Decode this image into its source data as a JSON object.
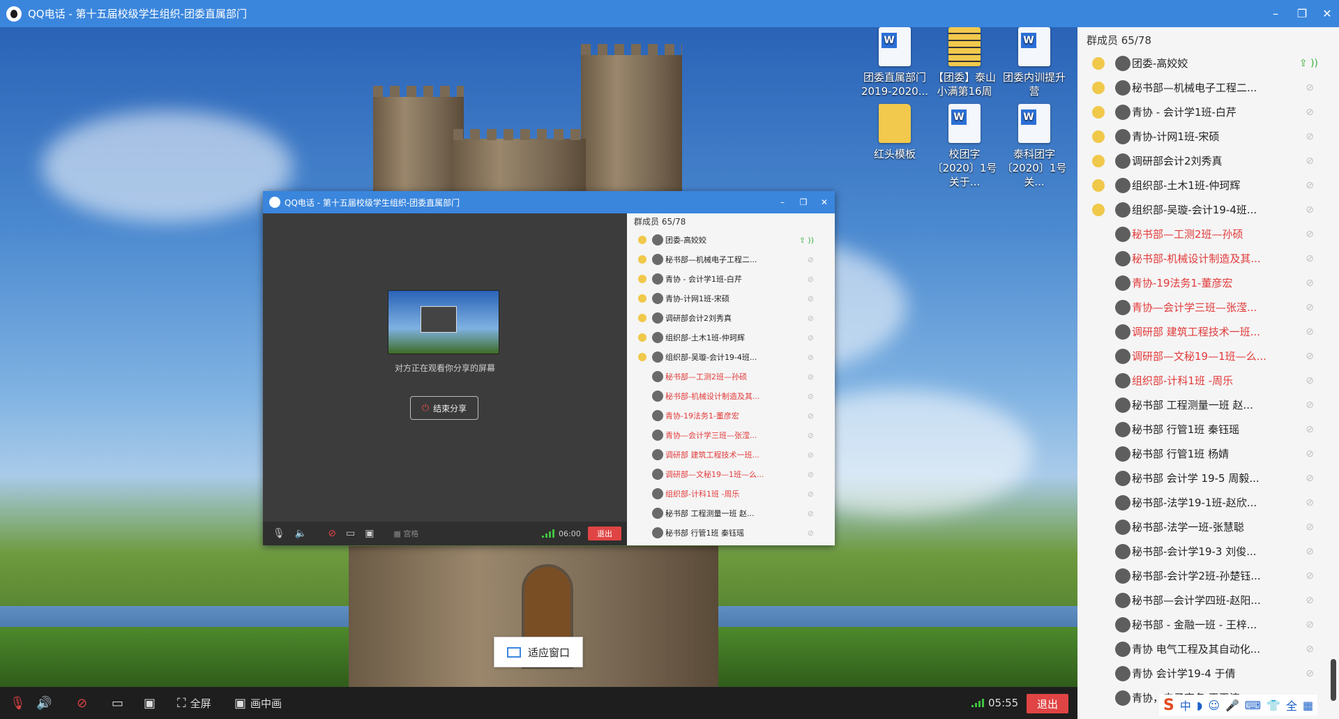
{
  "window": {
    "title": "QQ电话 - 第十五届校级学生组织-团委直属部门",
    "minimize": "–",
    "maximize": "❐",
    "close": "✕"
  },
  "desktop_icons": [
    {
      "label": "团委直属部门 2019-2020...",
      "kind": "word"
    },
    {
      "label": "【团委】泰山小满第16周",
      "kind": "zip"
    },
    {
      "label": "团委内训提升营",
      "kind": "word"
    },
    {
      "label": "红头模板",
      "kind": "folder"
    },
    {
      "label": "校团字〔2020〕1号关于...",
      "kind": "word"
    },
    {
      "label": "泰科团字〔2020〕1号关...",
      "kind": "word"
    }
  ],
  "inner_window": {
    "title": "QQ电话 - 第十五届校级学生组织-团委直属部门",
    "sharing_text": "对方正在观看你分享的屏幕",
    "end_share": "结束分享",
    "grid_label": "宫格",
    "timer": "06:00",
    "exit": "退出",
    "member_header": "群成员 65/78",
    "members": [
      {
        "name": "团委-高姣姣",
        "red": false
      },
      {
        "name": "秘书部—机械电子工程二...",
        "red": false
      },
      {
        "name": "青协 - 会计学1班-白芹",
        "red": false
      },
      {
        "name": "青协-计网1班-宋硕",
        "red": false
      },
      {
        "name": "调研部会计2刘秀真",
        "red": false
      },
      {
        "name": "组织部-土木1班-仲珂辉",
        "red": false
      },
      {
        "name": "组织部-吴璇-会计19-4班...",
        "red": false
      },
      {
        "name": "秘书部—工测2班—孙硕",
        "red": true
      },
      {
        "name": "秘书部-机械设计制造及其...",
        "red": true
      },
      {
        "name": "青协-19法务1-董彦宏",
        "red": true
      },
      {
        "name": "青协—会计学三班—张滢...",
        "red": true
      },
      {
        "name": "调研部 建筑工程技术一班...",
        "red": true
      },
      {
        "name": "调研部—文秘19—1班—么...",
        "red": true
      },
      {
        "name": "组织部-计科1班 -周乐",
        "red": true
      },
      {
        "name": "秘书部 工程测量一班 赵...",
        "red": false
      },
      {
        "name": "秘书部 行管1班 秦钰瑶",
        "red": false
      }
    ]
  },
  "fit_window": "适应窗口",
  "bottom_bar": {
    "fullscreen": "全屏",
    "pip": "画中画",
    "timer": "05:55",
    "exit": "退出"
  },
  "side_panel": {
    "header": "群成员 65/78",
    "members": [
      {
        "name": "团委-高姣姣",
        "red": false,
        "pi": true,
        "share": true
      },
      {
        "name": "秘书部—机械电子工程二...",
        "red": false,
        "pi": true
      },
      {
        "name": "青协 - 会计学1班-白芹",
        "red": false,
        "pi": true
      },
      {
        "name": "青协-计网1班-宋硕",
        "red": false,
        "pi": true
      },
      {
        "name": "调研部会计2刘秀真",
        "red": false,
        "pi": true
      },
      {
        "name": "组织部-土木1班-仲珂辉",
        "red": false,
        "pi": true
      },
      {
        "name": "组织部-吴璇-会计19-4班...",
        "red": false,
        "pi": true
      },
      {
        "name": "秘书部—工测2班—孙硕",
        "red": true,
        "pi": false
      },
      {
        "name": "秘书部-机械设计制造及其...",
        "red": true,
        "pi": false
      },
      {
        "name": "青协-19法务1-董彦宏",
        "red": true,
        "pi": false
      },
      {
        "name": "青协—会计学三班—张滢...",
        "red": true,
        "pi": false
      },
      {
        "name": "调研部 建筑工程技术一班...",
        "red": true,
        "pi": false
      },
      {
        "name": "调研部—文秘19—1班—么...",
        "red": true,
        "pi": false
      },
      {
        "name": "组织部-计科1班 -周乐",
        "red": true,
        "pi": false
      },
      {
        "name": "秘书部 工程测量一班 赵...",
        "red": false,
        "pi": false
      },
      {
        "name": "秘书部 行管1班 秦钰瑶",
        "red": false,
        "pi": false
      },
      {
        "name": "秘书部 行管1班 杨婧",
        "red": false,
        "pi": false
      },
      {
        "name": "秘书部 会计学 19-5 周毅...",
        "red": false,
        "pi": false
      },
      {
        "name": "秘书部-法学19-1班-赵欣...",
        "red": false,
        "pi": false
      },
      {
        "name": "秘书部-法学一班-张慧聪",
        "red": false,
        "pi": false
      },
      {
        "name": "秘书部-会计学19-3 刘俊...",
        "red": false,
        "pi": false
      },
      {
        "name": "秘书部-会计学2班-孙楚钰...",
        "red": false,
        "pi": false
      },
      {
        "name": "秘书部—会计学四班-赵阳...",
        "red": false,
        "pi": false
      },
      {
        "name": "秘书部 - 金融一班 - 王梓...",
        "red": false,
        "pi": false
      },
      {
        "name": "青协 电气工程及其自动化...",
        "red": false,
        "pi": false
      },
      {
        "name": "青协 会计学19-4 于倩",
        "red": false,
        "pi": false
      },
      {
        "name": "青协，电子商务 王玉涛",
        "red": false,
        "pi": false
      }
    ]
  },
  "ime": [
    "S",
    "中",
    "◗",
    "☺",
    "🎤",
    "⌨",
    "👕",
    "全",
    "▦"
  ]
}
